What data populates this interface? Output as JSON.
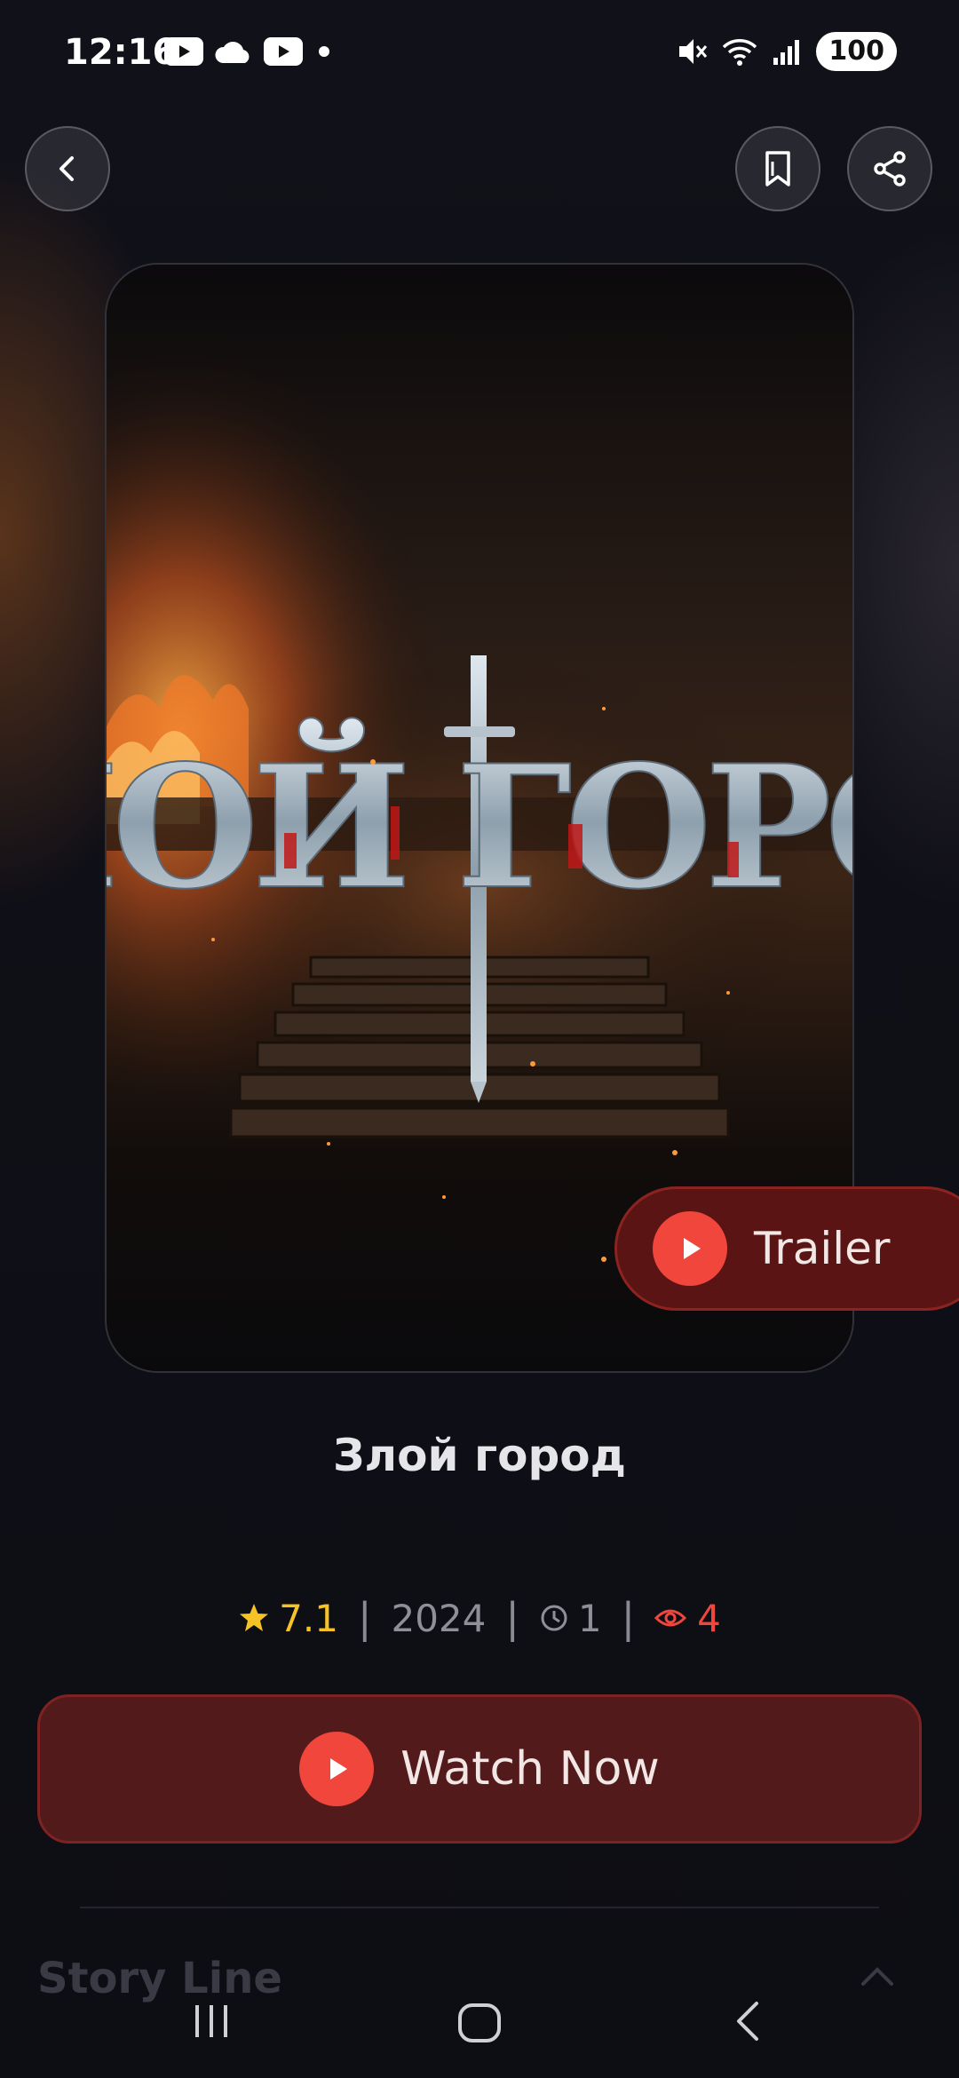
{
  "status_bar": {
    "time": "12:16",
    "battery": "100",
    "left_icons": [
      "youtube-icon",
      "cloud-icon",
      "youtube-icon",
      "dot-icon"
    ],
    "right_icons": [
      "mute-icon",
      "wifi-icon",
      "signal-icon"
    ]
  },
  "header": {
    "back_icon": "chevron-left-icon",
    "bookmark_icon": "bookmark-icon",
    "share_icon": "share-icon"
  },
  "poster": {
    "title_art": "ЗЛОЙ ГОРОД"
  },
  "trailer": {
    "label": "Trailer"
  },
  "movie": {
    "title": "Злой город",
    "rating": "7.1",
    "year": "2024",
    "episodes": "1",
    "views": "4"
  },
  "actions": {
    "watch_label": "Watch Now"
  },
  "sections": {
    "storyline_title": "Story Line"
  },
  "colors": {
    "accent": "#f0463c",
    "rating": "#f5c325",
    "button_bg": "#531a1c",
    "background": "#0f0f16"
  }
}
